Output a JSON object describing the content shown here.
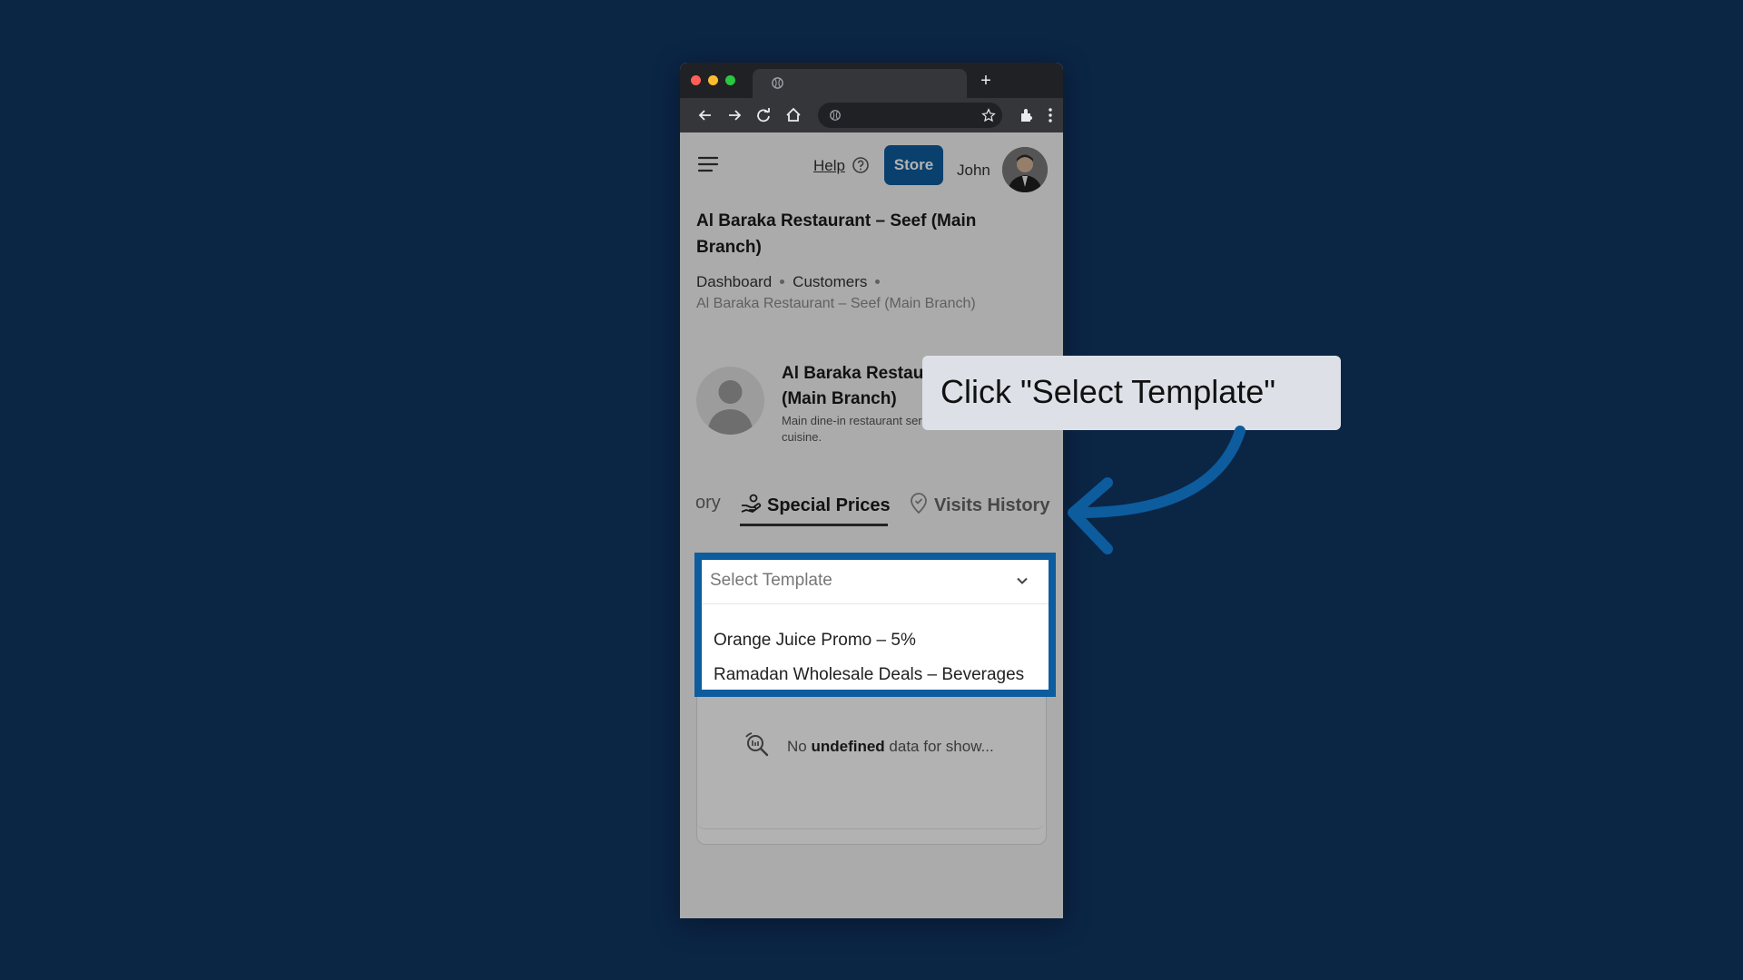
{
  "browser": {
    "new_tab_label": "+"
  },
  "header": {
    "help_label": "Help",
    "store_label": "Store",
    "user_name": "John"
  },
  "page": {
    "title": "Al Baraka Restaurant – Seef (Main Branch)",
    "breadcrumbs": [
      "Dashboard",
      "Customers"
    ],
    "breadcrumb_current": "Al Baraka Restaurant – Seef (Main Branch)"
  },
  "profile": {
    "name": "Al Baraka Restaurant – Seef (Main Branch)",
    "description": "Main dine-in restaurant serving traditional cuisine."
  },
  "tabs": {
    "history_partial": "ory",
    "special_prices": "Special Prices",
    "visits_history": "Visits History"
  },
  "template_select": {
    "placeholder": "Select Template",
    "options": [
      "Orange Juice Promo – 5%",
      "Ramadan Wholesale Deals – Beverages"
    ]
  },
  "empty_state": {
    "prefix": "No",
    "bold": "undefined",
    "suffix": "data for show..."
  },
  "callout": {
    "text": "Click \"Select Template\""
  },
  "colors": {
    "background": "#0b2545",
    "accent": "#0d5c9e"
  }
}
